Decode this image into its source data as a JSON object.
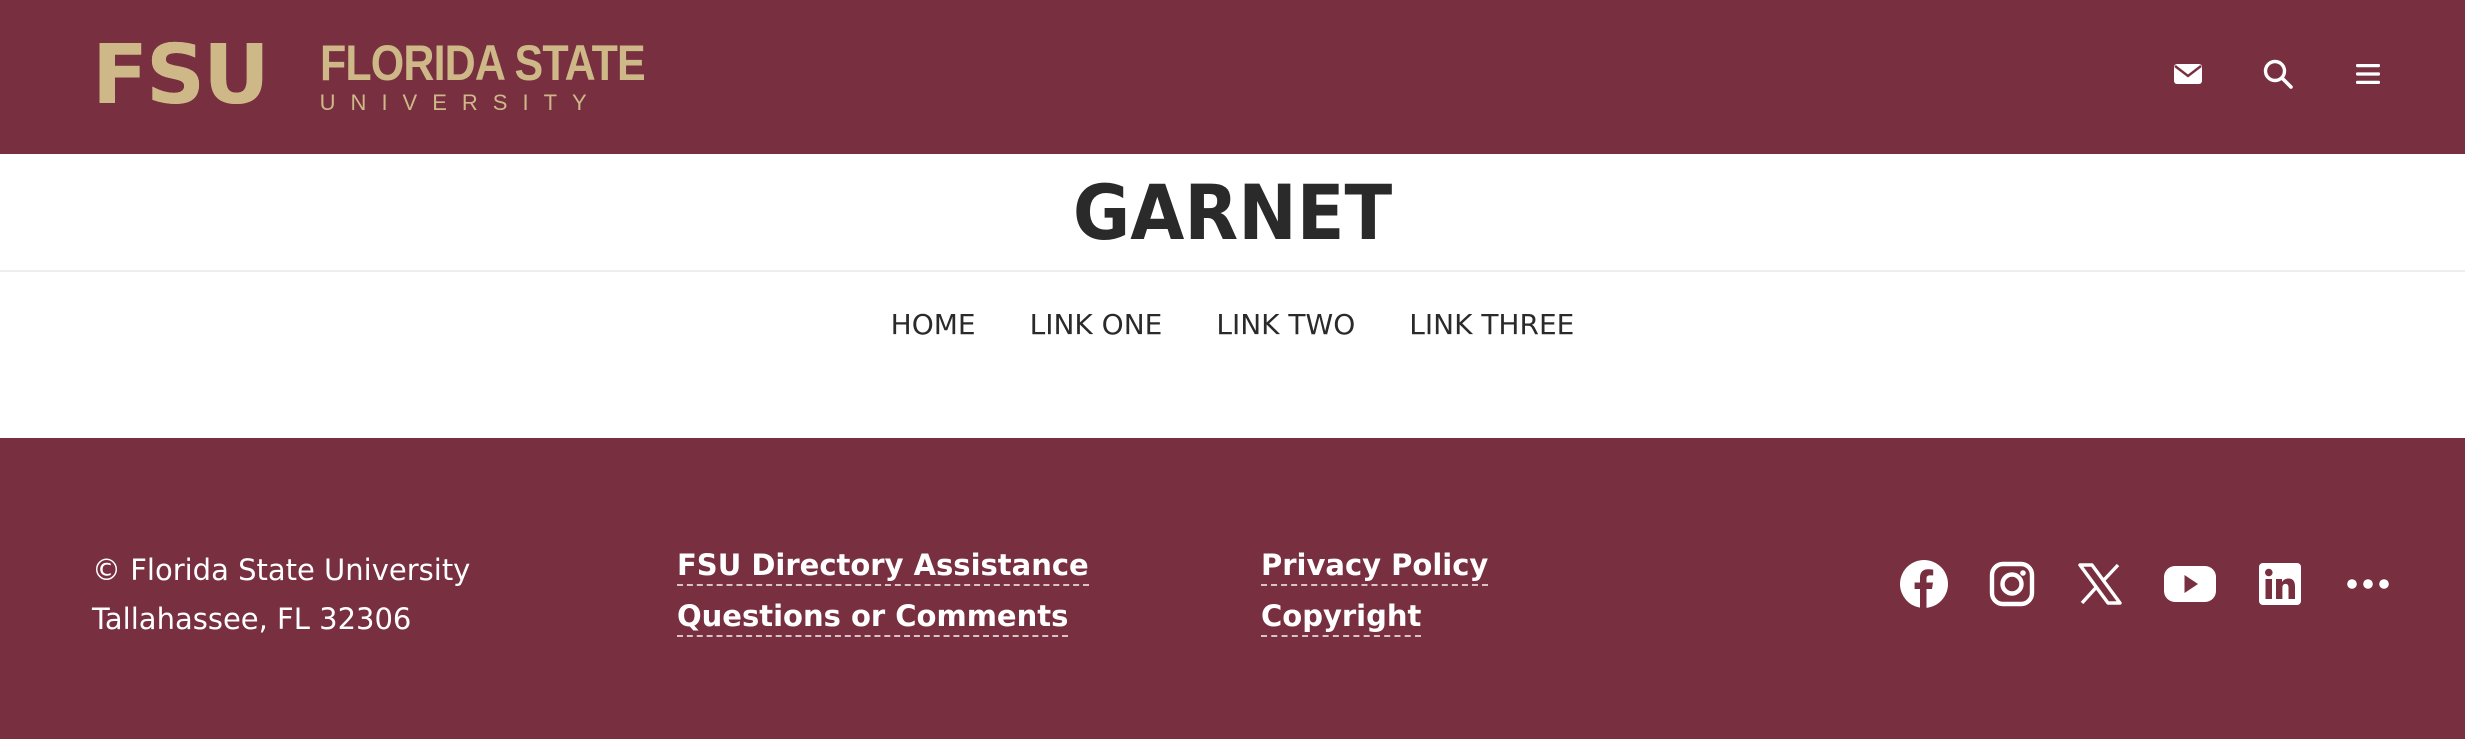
{
  "header": {
    "logo_mark": "FSU",
    "logo_name": "FLORIDA STATE",
    "logo_sub": "UNIVERSITY",
    "icons": [
      "mail-icon",
      "search-icon",
      "menu-icon"
    ]
  },
  "site": {
    "title": "GARNET"
  },
  "nav": {
    "items": [
      {
        "label": "HOME"
      },
      {
        "label": "LINK ONE"
      },
      {
        "label": "LINK TWO"
      },
      {
        "label": "LINK THREE"
      }
    ]
  },
  "footer": {
    "address": [
      "© Florida State University",
      "Tallahassee, FL 32306"
    ],
    "links_col1": [
      "FSU Directory Assistance",
      "Questions or Comments"
    ],
    "links_col2": [
      "Privacy Policy",
      "Copyright"
    ],
    "social": [
      "facebook-icon",
      "instagram-icon",
      "x-icon",
      "youtube-icon",
      "linkedin-icon",
      "more-icon"
    ]
  },
  "colors": {
    "garnet": "#782f40",
    "gold": "#ceb888",
    "text_dark": "#2a2a2a",
    "white": "#ffffff"
  }
}
